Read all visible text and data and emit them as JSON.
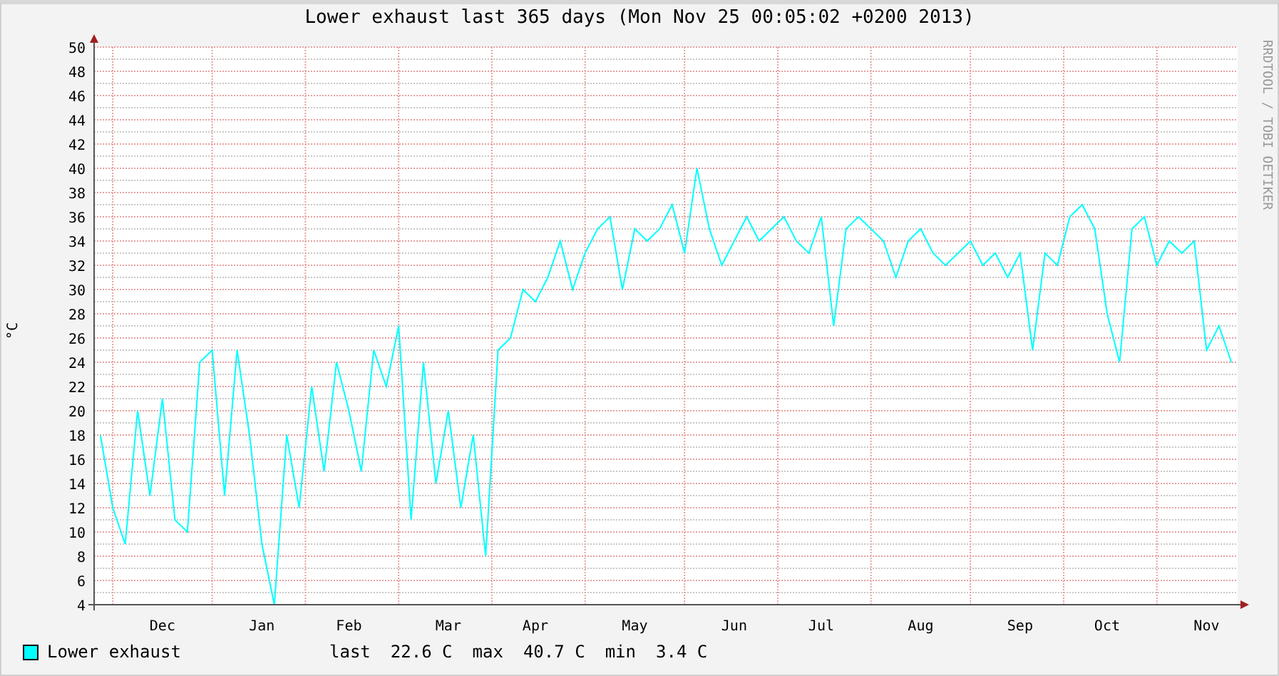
{
  "title": "Lower exhaust last 365 days (Mon Nov 25 00:05:02 +0200 2013)",
  "credit": "RRDTOOL / TOBI OETIKER",
  "chart_data": {
    "type": "line",
    "ylabel": "°C",
    "ylim": [
      4,
      50
    ],
    "grid": true,
    "yticks": [
      4,
      6,
      8,
      10,
      12,
      14,
      16,
      18,
      20,
      22,
      24,
      26,
      28,
      30,
      32,
      34,
      36,
      38,
      40,
      42,
      44,
      46,
      48,
      50
    ],
    "categories": [
      null,
      null,
      null,
      null,
      null,
      "Dec",
      null,
      null,
      null,
      null,
      null,
      null,
      null,
      "Jan",
      null,
      null,
      null,
      null,
      null,
      null,
      "Feb",
      null,
      null,
      null,
      null,
      null,
      null,
      null,
      "Mar",
      null,
      null,
      null,
      null,
      null,
      null,
      "Apr",
      null,
      null,
      null,
      null,
      null,
      null,
      null,
      "May",
      null,
      null,
      null,
      null,
      null,
      null,
      null,
      "Jun",
      null,
      null,
      null,
      null,
      null,
      null,
      "Jul",
      null,
      null,
      null,
      null,
      null,
      null,
      null,
      "Aug",
      null,
      null,
      null,
      null,
      null,
      null,
      null,
      "Sep",
      null,
      null,
      null,
      null,
      null,
      null,
      "Oct",
      null,
      null,
      null,
      null,
      null,
      null,
      null,
      "Nov",
      null,
      null
    ],
    "series": [
      {
        "name": "Lower exhaust",
        "color": "#00ffff",
        "values": [
          18,
          12,
          9,
          20,
          13,
          21,
          11,
          10,
          24,
          25,
          13,
          25,
          18,
          9,
          4,
          18,
          12,
          22,
          15,
          24,
          20,
          15,
          25,
          22,
          27,
          11,
          24,
          14,
          20,
          12,
          18,
          8,
          25,
          26,
          30,
          29,
          31,
          34,
          30,
          33,
          35,
          36,
          30,
          35,
          34,
          35,
          37,
          33,
          40,
          35,
          32,
          34,
          36,
          34,
          35,
          36,
          34,
          33,
          36,
          27,
          35,
          36,
          35,
          34,
          31,
          34,
          35,
          33,
          32,
          33,
          34,
          32,
          33,
          31,
          33,
          25,
          33,
          32,
          36,
          37,
          35,
          28,
          24,
          35,
          36,
          32,
          34,
          33,
          34,
          25,
          27,
          24
        ]
      }
    ]
  },
  "legend": [
    {
      "stats": [
        {
          "label": "last",
          "value": "22.6 C"
        },
        {
          "label": "max",
          "value": "40.7 C"
        },
        {
          "label": "min",
          "value": "3.4 C"
        }
      ]
    }
  ]
}
